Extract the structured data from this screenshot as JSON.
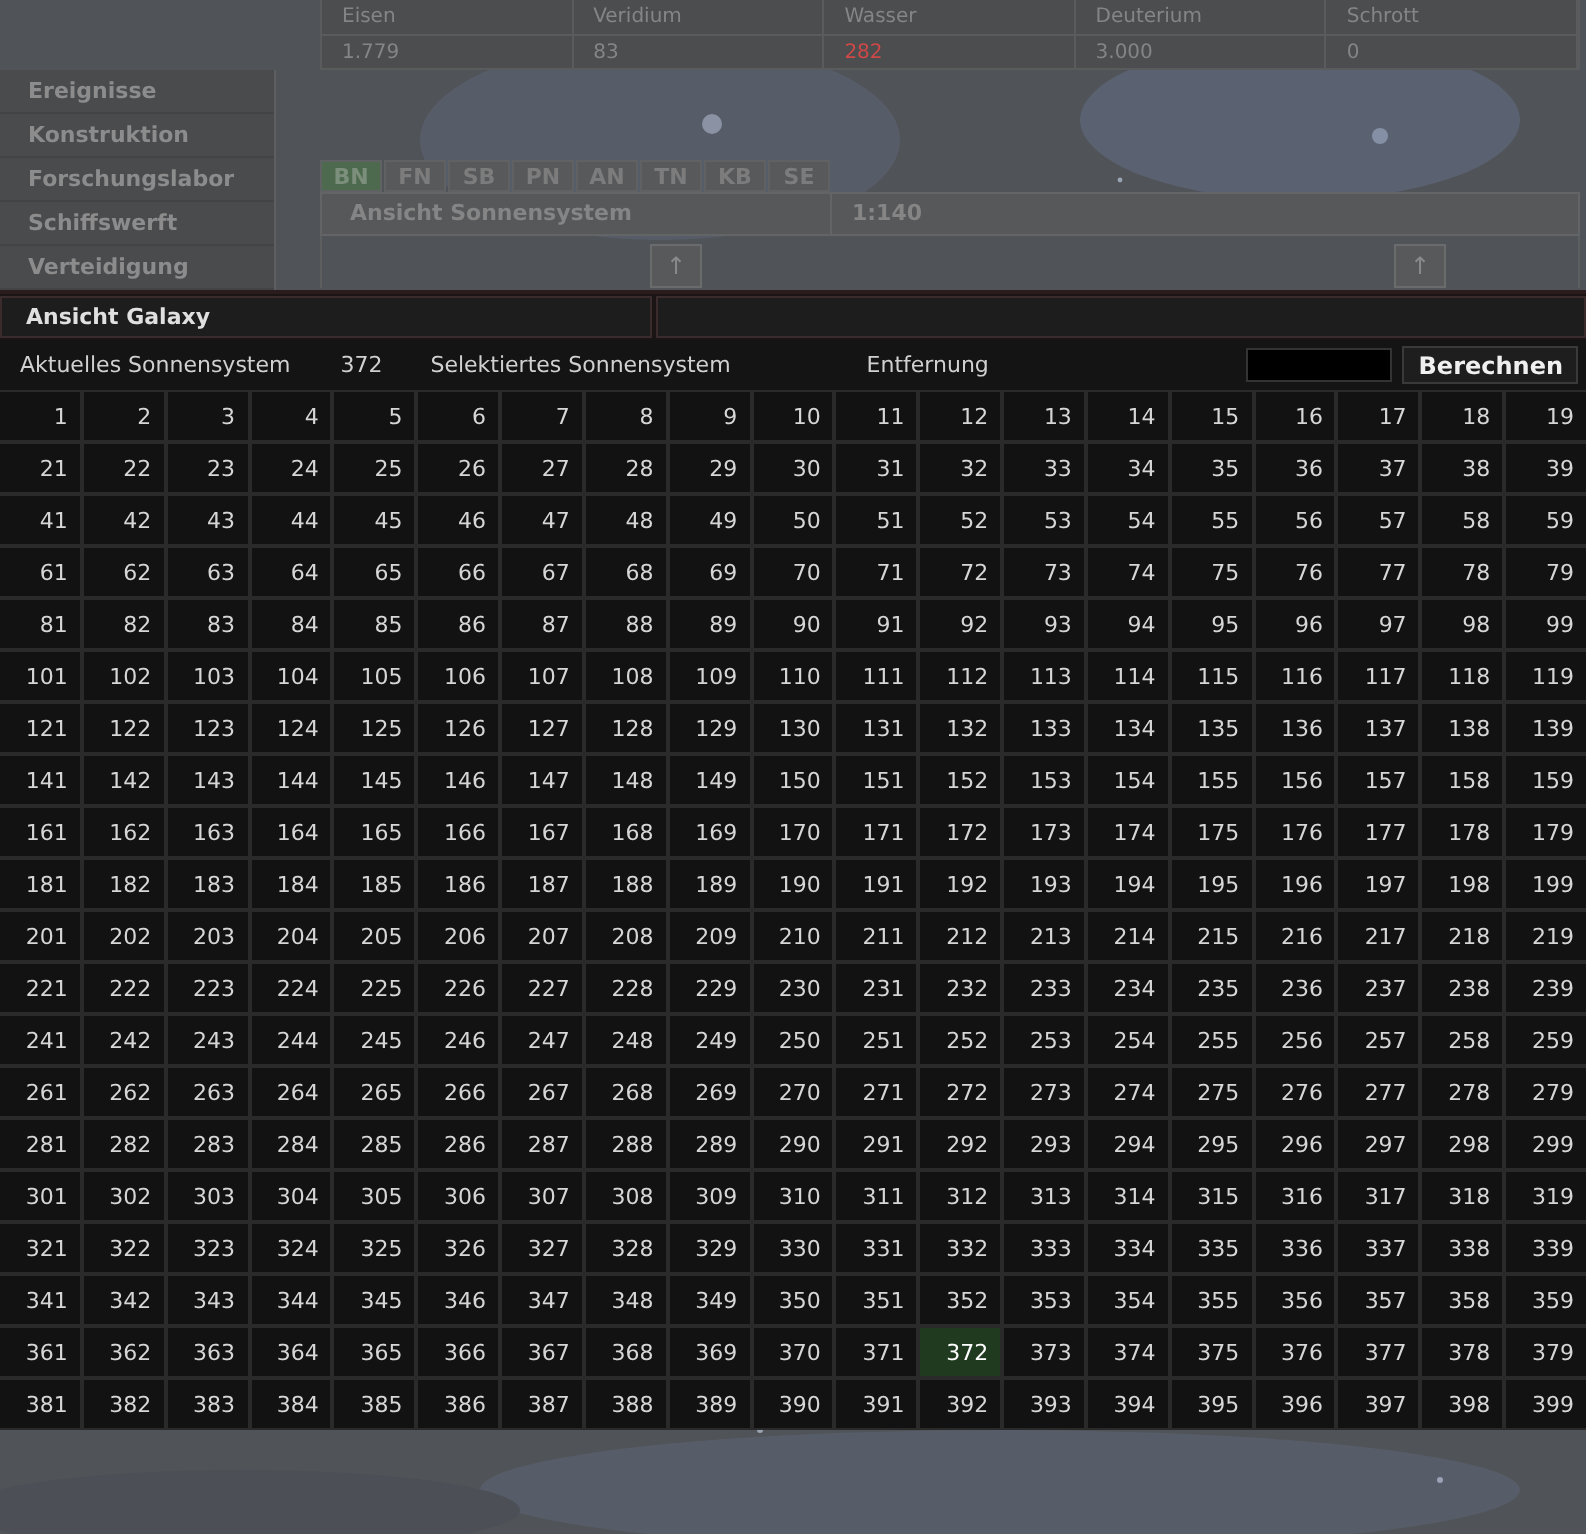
{
  "resources": [
    {
      "name": "Eisen",
      "value": "1.779",
      "warning": false
    },
    {
      "name": "Veridium",
      "value": "83",
      "warning": false
    },
    {
      "name": "Wasser",
      "value": "282",
      "warning": true
    },
    {
      "name": "Deuterium",
      "value": "3.000",
      "warning": false
    },
    {
      "name": "Schrott",
      "value": "0",
      "warning": false
    }
  ],
  "sidebar": {
    "items": [
      "Ereignisse",
      "Konstruktion",
      "Forschungslabor",
      "Schiffswerft",
      "Verteidigung"
    ]
  },
  "tabs": [
    {
      "label": "BN",
      "selected": true
    },
    {
      "label": "FN",
      "selected": false
    },
    {
      "label": "SB",
      "selected": false
    },
    {
      "label": "PN",
      "selected": false
    },
    {
      "label": "AN",
      "selected": false
    },
    {
      "label": "TN",
      "selected": false
    },
    {
      "label": "KB",
      "selected": false
    },
    {
      "label": "SE",
      "selected": false
    }
  ],
  "system_view": {
    "title": "Ansicht Sonnensystem",
    "scale": "1:140",
    "arrows": [
      "↑",
      "↑"
    ]
  },
  "galaxy": {
    "title": "Ansicht Galaxy",
    "current_label": "Aktuelles Sonnensystem",
    "current_value": "372",
    "selected_label": "Selektiertes Sonnensystem",
    "distance_label": "Entfernung",
    "button": "Berechnen",
    "rows": [
      [
        {
          "label": "1",
          "selected": false
        },
        {
          "label": "2",
          "selected": false
        },
        {
          "label": "3",
          "selected": false
        },
        {
          "label": "4",
          "selected": false
        },
        {
          "label": "5",
          "selected": false
        },
        {
          "label": "6",
          "selected": false
        },
        {
          "label": "7",
          "selected": false
        },
        {
          "label": "8",
          "selected": false
        },
        {
          "label": "9",
          "selected": false
        },
        {
          "label": "10",
          "selected": false
        },
        {
          "label": "11",
          "selected": false
        },
        {
          "label": "12",
          "selected": false
        },
        {
          "label": "13",
          "selected": false
        },
        {
          "label": "14",
          "selected": false
        },
        {
          "label": "15",
          "selected": false
        },
        {
          "label": "16",
          "selected": false
        },
        {
          "label": "17",
          "selected": false
        },
        {
          "label": "18",
          "selected": false
        },
        {
          "label": "19",
          "selected": false
        }
      ],
      [
        {
          "label": "21",
          "selected": false
        },
        {
          "label": "22",
          "selected": false
        },
        {
          "label": "23",
          "selected": false
        },
        {
          "label": "24",
          "selected": false
        },
        {
          "label": "25",
          "selected": false
        },
        {
          "label": "26",
          "selected": false
        },
        {
          "label": "27",
          "selected": false
        },
        {
          "label": "28",
          "selected": false
        },
        {
          "label": "29",
          "selected": false
        },
        {
          "label": "30",
          "selected": false
        },
        {
          "label": "31",
          "selected": false
        },
        {
          "label": "32",
          "selected": false
        },
        {
          "label": "33",
          "selected": false
        },
        {
          "label": "34",
          "selected": false
        },
        {
          "label": "35",
          "selected": false
        },
        {
          "label": "36",
          "selected": false
        },
        {
          "label": "37",
          "selected": false
        },
        {
          "label": "38",
          "selected": false
        },
        {
          "label": "39",
          "selected": false
        }
      ],
      [
        {
          "label": "41",
          "selected": false
        },
        {
          "label": "42",
          "selected": false
        },
        {
          "label": "43",
          "selected": false
        },
        {
          "label": "44",
          "selected": false
        },
        {
          "label": "45",
          "selected": false
        },
        {
          "label": "46",
          "selected": false
        },
        {
          "label": "47",
          "selected": false
        },
        {
          "label": "48",
          "selected": false
        },
        {
          "label": "49",
          "selected": false
        },
        {
          "label": "50",
          "selected": false
        },
        {
          "label": "51",
          "selected": false
        },
        {
          "label": "52",
          "selected": false
        },
        {
          "label": "53",
          "selected": false
        },
        {
          "label": "54",
          "selected": false
        },
        {
          "label": "55",
          "selected": false
        },
        {
          "label": "56",
          "selected": false
        },
        {
          "label": "57",
          "selected": false
        },
        {
          "label": "58",
          "selected": false
        },
        {
          "label": "59",
          "selected": false
        }
      ],
      [
        {
          "label": "61",
          "selected": false
        },
        {
          "label": "62",
          "selected": false
        },
        {
          "label": "63",
          "selected": false
        },
        {
          "label": "64",
          "selected": false
        },
        {
          "label": "65",
          "selected": false
        },
        {
          "label": "66",
          "selected": false
        },
        {
          "label": "67",
          "selected": false
        },
        {
          "label": "68",
          "selected": false
        },
        {
          "label": "69",
          "selected": false
        },
        {
          "label": "70",
          "selected": false
        },
        {
          "label": "71",
          "selected": false
        },
        {
          "label": "72",
          "selected": false
        },
        {
          "label": "73",
          "selected": false
        },
        {
          "label": "74",
          "selected": false
        },
        {
          "label": "75",
          "selected": false
        },
        {
          "label": "76",
          "selected": false
        },
        {
          "label": "77",
          "selected": false
        },
        {
          "label": "78",
          "selected": false
        },
        {
          "label": "79",
          "selected": false
        }
      ],
      [
        {
          "label": "81",
          "selected": false
        },
        {
          "label": "82",
          "selected": false
        },
        {
          "label": "83",
          "selected": false
        },
        {
          "label": "84",
          "selected": false
        },
        {
          "label": "85",
          "selected": false
        },
        {
          "label": "86",
          "selected": false
        },
        {
          "label": "87",
          "selected": false
        },
        {
          "label": "88",
          "selected": false
        },
        {
          "label": "89",
          "selected": false
        },
        {
          "label": "90",
          "selected": false
        },
        {
          "label": "91",
          "selected": false
        },
        {
          "label": "92",
          "selected": false
        },
        {
          "label": "93",
          "selected": false
        },
        {
          "label": "94",
          "selected": false
        },
        {
          "label": "95",
          "selected": false
        },
        {
          "label": "96",
          "selected": false
        },
        {
          "label": "97",
          "selected": false
        },
        {
          "label": "98",
          "selected": false
        },
        {
          "label": "99",
          "selected": false
        }
      ],
      [
        {
          "label": "101",
          "selected": false
        },
        {
          "label": "102",
          "selected": false
        },
        {
          "label": "103",
          "selected": false
        },
        {
          "label": "104",
          "selected": false
        },
        {
          "label": "105",
          "selected": false
        },
        {
          "label": "106",
          "selected": false
        },
        {
          "label": "107",
          "selected": false
        },
        {
          "label": "108",
          "selected": false
        },
        {
          "label": "109",
          "selected": false
        },
        {
          "label": "110",
          "selected": false
        },
        {
          "label": "111",
          "selected": false
        },
        {
          "label": "112",
          "selected": false
        },
        {
          "label": "113",
          "selected": false
        },
        {
          "label": "114",
          "selected": false
        },
        {
          "label": "115",
          "selected": false
        },
        {
          "label": "116",
          "selected": false
        },
        {
          "label": "117",
          "selected": false
        },
        {
          "label": "118",
          "selected": false
        },
        {
          "label": "119",
          "selected": false
        }
      ],
      [
        {
          "label": "121",
          "selected": false
        },
        {
          "label": "122",
          "selected": false
        },
        {
          "label": "123",
          "selected": false
        },
        {
          "label": "124",
          "selected": false
        },
        {
          "label": "125",
          "selected": false
        },
        {
          "label": "126",
          "selected": false
        },
        {
          "label": "127",
          "selected": false
        },
        {
          "label": "128",
          "selected": false
        },
        {
          "label": "129",
          "selected": false
        },
        {
          "label": "130",
          "selected": false
        },
        {
          "label": "131",
          "selected": false
        },
        {
          "label": "132",
          "selected": false
        },
        {
          "label": "133",
          "selected": false
        },
        {
          "label": "134",
          "selected": false
        },
        {
          "label": "135",
          "selected": false
        },
        {
          "label": "136",
          "selected": false
        },
        {
          "label": "137",
          "selected": false
        },
        {
          "label": "138",
          "selected": false
        },
        {
          "label": "139",
          "selected": false
        }
      ],
      [
        {
          "label": "141",
          "selected": false
        },
        {
          "label": "142",
          "selected": false
        },
        {
          "label": "143",
          "selected": false
        },
        {
          "label": "144",
          "selected": false
        },
        {
          "label": "145",
          "selected": false
        },
        {
          "label": "146",
          "selected": false
        },
        {
          "label": "147",
          "selected": false
        },
        {
          "label": "148",
          "selected": false
        },
        {
          "label": "149",
          "selected": false
        },
        {
          "label": "150",
          "selected": false
        },
        {
          "label": "151",
          "selected": false
        },
        {
          "label": "152",
          "selected": false
        },
        {
          "label": "153",
          "selected": false
        },
        {
          "label": "154",
          "selected": false
        },
        {
          "label": "155",
          "selected": false
        },
        {
          "label": "156",
          "selected": false
        },
        {
          "label": "157",
          "selected": false
        },
        {
          "label": "158",
          "selected": false
        },
        {
          "label": "159",
          "selected": false
        }
      ],
      [
        {
          "label": "161",
          "selected": false
        },
        {
          "label": "162",
          "selected": false
        },
        {
          "label": "163",
          "selected": false
        },
        {
          "label": "164",
          "selected": false
        },
        {
          "label": "165",
          "selected": false
        },
        {
          "label": "166",
          "selected": false
        },
        {
          "label": "167",
          "selected": false
        },
        {
          "label": "168",
          "selected": false
        },
        {
          "label": "169",
          "selected": false
        },
        {
          "label": "170",
          "selected": false
        },
        {
          "label": "171",
          "selected": false
        },
        {
          "label": "172",
          "selected": false
        },
        {
          "label": "173",
          "selected": false
        },
        {
          "label": "174",
          "selected": false
        },
        {
          "label": "175",
          "selected": false
        },
        {
          "label": "176",
          "selected": false
        },
        {
          "label": "177",
          "selected": false
        },
        {
          "label": "178",
          "selected": false
        },
        {
          "label": "179",
          "selected": false
        }
      ],
      [
        {
          "label": "181",
          "selected": false
        },
        {
          "label": "182",
          "selected": false
        },
        {
          "label": "183",
          "selected": false
        },
        {
          "label": "184",
          "selected": false
        },
        {
          "label": "185",
          "selected": false
        },
        {
          "label": "186",
          "selected": false
        },
        {
          "label": "187",
          "selected": false
        },
        {
          "label": "188",
          "selected": false
        },
        {
          "label": "189",
          "selected": false
        },
        {
          "label": "190",
          "selected": false
        },
        {
          "label": "191",
          "selected": false
        },
        {
          "label": "192",
          "selected": false
        },
        {
          "label": "193",
          "selected": false
        },
        {
          "label": "194",
          "selected": false
        },
        {
          "label": "195",
          "selected": false
        },
        {
          "label": "196",
          "selected": false
        },
        {
          "label": "197",
          "selected": false
        },
        {
          "label": "198",
          "selected": false
        },
        {
          "label": "199",
          "selected": false
        }
      ],
      [
        {
          "label": "201",
          "selected": false
        },
        {
          "label": "202",
          "selected": false
        },
        {
          "label": "203",
          "selected": false
        },
        {
          "label": "204",
          "selected": false
        },
        {
          "label": "205",
          "selected": false
        },
        {
          "label": "206",
          "selected": false
        },
        {
          "label": "207",
          "selected": false
        },
        {
          "label": "208",
          "selected": false
        },
        {
          "label": "209",
          "selected": false
        },
        {
          "label": "210",
          "selected": false
        },
        {
          "label": "211",
          "selected": false
        },
        {
          "label": "212",
          "selected": false
        },
        {
          "label": "213",
          "selected": false
        },
        {
          "label": "214",
          "selected": false
        },
        {
          "label": "215",
          "selected": false
        },
        {
          "label": "216",
          "selected": false
        },
        {
          "label": "217",
          "selected": false
        },
        {
          "label": "218",
          "selected": false
        },
        {
          "label": "219",
          "selected": false
        }
      ],
      [
        {
          "label": "221",
          "selected": false
        },
        {
          "label": "222",
          "selected": false
        },
        {
          "label": "223",
          "selected": false
        },
        {
          "label": "224",
          "selected": false
        },
        {
          "label": "225",
          "selected": false
        },
        {
          "label": "226",
          "selected": false
        },
        {
          "label": "227",
          "selected": false
        },
        {
          "label": "228",
          "selected": false
        },
        {
          "label": "229",
          "selected": false
        },
        {
          "label": "230",
          "selected": false
        },
        {
          "label": "231",
          "selected": false
        },
        {
          "label": "232",
          "selected": false
        },
        {
          "label": "233",
          "selected": false
        },
        {
          "label": "234",
          "selected": false
        },
        {
          "label": "235",
          "selected": false
        },
        {
          "label": "236",
          "selected": false
        },
        {
          "label": "237",
          "selected": false
        },
        {
          "label": "238",
          "selected": false
        },
        {
          "label": "239",
          "selected": false
        }
      ],
      [
        {
          "label": "241",
          "selected": false
        },
        {
          "label": "242",
          "selected": false
        },
        {
          "label": "243",
          "selected": false
        },
        {
          "label": "244",
          "selected": false
        },
        {
          "label": "245",
          "selected": false
        },
        {
          "label": "246",
          "selected": false
        },
        {
          "label": "247",
          "selected": false
        },
        {
          "label": "248",
          "selected": false
        },
        {
          "label": "249",
          "selected": false
        },
        {
          "label": "250",
          "selected": false
        },
        {
          "label": "251",
          "selected": false
        },
        {
          "label": "252",
          "selected": false
        },
        {
          "label": "253",
          "selected": false
        },
        {
          "label": "254",
          "selected": false
        },
        {
          "label": "255",
          "selected": false
        },
        {
          "label": "256",
          "selected": false
        },
        {
          "label": "257",
          "selected": false
        },
        {
          "label": "258",
          "selected": false
        },
        {
          "label": "259",
          "selected": false
        }
      ],
      [
        {
          "label": "261",
          "selected": false
        },
        {
          "label": "262",
          "selected": false
        },
        {
          "label": "263",
          "selected": false
        },
        {
          "label": "264",
          "selected": false
        },
        {
          "label": "265",
          "selected": false
        },
        {
          "label": "266",
          "selected": false
        },
        {
          "label": "267",
          "selected": false
        },
        {
          "label": "268",
          "selected": false
        },
        {
          "label": "269",
          "selected": false
        },
        {
          "label": "270",
          "selected": false
        },
        {
          "label": "271",
          "selected": false
        },
        {
          "label": "272",
          "selected": false
        },
        {
          "label": "273",
          "selected": false
        },
        {
          "label": "274",
          "selected": false
        },
        {
          "label": "275",
          "selected": false
        },
        {
          "label": "276",
          "selected": false
        },
        {
          "label": "277",
          "selected": false
        },
        {
          "label": "278",
          "selected": false
        },
        {
          "label": "279",
          "selected": false
        }
      ],
      [
        {
          "label": "281",
          "selected": false
        },
        {
          "label": "282",
          "selected": false
        },
        {
          "label": "283",
          "selected": false
        },
        {
          "label": "284",
          "selected": false
        },
        {
          "label": "285",
          "selected": false
        },
        {
          "label": "286",
          "selected": false
        },
        {
          "label": "287",
          "selected": false
        },
        {
          "label": "288",
          "selected": false
        },
        {
          "label": "289",
          "selected": false
        },
        {
          "label": "290",
          "selected": false
        },
        {
          "label": "291",
          "selected": false
        },
        {
          "label": "292",
          "selected": false
        },
        {
          "label": "293",
          "selected": false
        },
        {
          "label": "294",
          "selected": false
        },
        {
          "label": "295",
          "selected": false
        },
        {
          "label": "296",
          "selected": false
        },
        {
          "label": "297",
          "selected": false
        },
        {
          "label": "298",
          "selected": false
        },
        {
          "label": "299",
          "selected": false
        }
      ],
      [
        {
          "label": "301",
          "selected": false
        },
        {
          "label": "302",
          "selected": false
        },
        {
          "label": "303",
          "selected": false
        },
        {
          "label": "304",
          "selected": false
        },
        {
          "label": "305",
          "selected": false
        },
        {
          "label": "306",
          "selected": false
        },
        {
          "label": "307",
          "selected": false
        },
        {
          "label": "308",
          "selected": false
        },
        {
          "label": "309",
          "selected": false
        },
        {
          "label": "310",
          "selected": false
        },
        {
          "label": "311",
          "selected": false
        },
        {
          "label": "312",
          "selected": false
        },
        {
          "label": "313",
          "selected": false
        },
        {
          "label": "314",
          "selected": false
        },
        {
          "label": "315",
          "selected": false
        },
        {
          "label": "316",
          "selected": false
        },
        {
          "label": "317",
          "selected": false
        },
        {
          "label": "318",
          "selected": false
        },
        {
          "label": "319",
          "selected": false
        }
      ],
      [
        {
          "label": "321",
          "selected": false
        },
        {
          "label": "322",
          "selected": false
        },
        {
          "label": "323",
          "selected": false
        },
        {
          "label": "324",
          "selected": false
        },
        {
          "label": "325",
          "selected": false
        },
        {
          "label": "326",
          "selected": false
        },
        {
          "label": "327",
          "selected": false
        },
        {
          "label": "328",
          "selected": false
        },
        {
          "label": "329",
          "selected": false
        },
        {
          "label": "330",
          "selected": false
        },
        {
          "label": "331",
          "selected": false
        },
        {
          "label": "332",
          "selected": false
        },
        {
          "label": "333",
          "selected": false
        },
        {
          "label": "334",
          "selected": false
        },
        {
          "label": "335",
          "selected": false
        },
        {
          "label": "336",
          "selected": false
        },
        {
          "label": "337",
          "selected": false
        },
        {
          "label": "338",
          "selected": false
        },
        {
          "label": "339",
          "selected": false
        }
      ],
      [
        {
          "label": "341",
          "selected": false
        },
        {
          "label": "342",
          "selected": false
        },
        {
          "label": "343",
          "selected": false
        },
        {
          "label": "344",
          "selected": false
        },
        {
          "label": "345",
          "selected": false
        },
        {
          "label": "346",
          "selected": false
        },
        {
          "label": "347",
          "selected": false
        },
        {
          "label": "348",
          "selected": false
        },
        {
          "label": "349",
          "selected": false
        },
        {
          "label": "350",
          "selected": false
        },
        {
          "label": "351",
          "selected": false
        },
        {
          "label": "352",
          "selected": false
        },
        {
          "label": "353",
          "selected": false
        },
        {
          "label": "354",
          "selected": false
        },
        {
          "label": "355",
          "selected": false
        },
        {
          "label": "356",
          "selected": false
        },
        {
          "label": "357",
          "selected": false
        },
        {
          "label": "358",
          "selected": false
        },
        {
          "label": "359",
          "selected": false
        }
      ],
      [
        {
          "label": "361",
          "selected": false
        },
        {
          "label": "362",
          "selected": false
        },
        {
          "label": "363",
          "selected": false
        },
        {
          "label": "364",
          "selected": false
        },
        {
          "label": "365",
          "selected": false
        },
        {
          "label": "366",
          "selected": false
        },
        {
          "label": "367",
          "selected": false
        },
        {
          "label": "368",
          "selected": false
        },
        {
          "label": "369",
          "selected": false
        },
        {
          "label": "370",
          "selected": false
        },
        {
          "label": "371",
          "selected": false
        },
        {
          "label": "372",
          "selected": true
        },
        {
          "label": "373",
          "selected": false
        },
        {
          "label": "374",
          "selected": false
        },
        {
          "label": "375",
          "selected": false
        },
        {
          "label": "376",
          "selected": false
        },
        {
          "label": "377",
          "selected": false
        },
        {
          "label": "378",
          "selected": false
        },
        {
          "label": "379",
          "selected": false
        }
      ],
      [
        {
          "label": "381",
          "selected": false
        },
        {
          "label": "382",
          "selected": false
        },
        {
          "label": "383",
          "selected": false
        },
        {
          "label": "384",
          "selected": false
        },
        {
          "label": "385",
          "selected": false
        },
        {
          "label": "386",
          "selected": false
        },
        {
          "label": "387",
          "selected": false
        },
        {
          "label": "388",
          "selected": false
        },
        {
          "label": "389",
          "selected": false
        },
        {
          "label": "390",
          "selected": false
        },
        {
          "label": "391",
          "selected": false
        },
        {
          "label": "392",
          "selected": false
        },
        {
          "label": "393",
          "selected": false
        },
        {
          "label": "394",
          "selected": false
        },
        {
          "label": "395",
          "selected": false
        },
        {
          "label": "396",
          "selected": false
        },
        {
          "label": "397",
          "selected": false
        },
        {
          "label": "398",
          "selected": false
        },
        {
          "label": "399",
          "selected": false
        }
      ]
    ]
  }
}
